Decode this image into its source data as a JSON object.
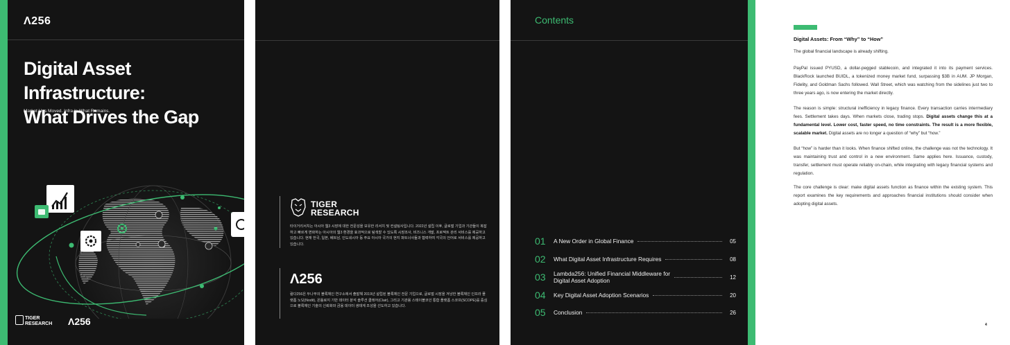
{
  "cover": {
    "logo": "Λ256",
    "title_line1": "Digital Asset Infrastructure:",
    "title_line2": "What Drives the Gap",
    "subtitle": "Market Has Moved. Infra Is What Remains.",
    "footer_logo_tiger_line1": "TIGER",
    "footer_logo_tiger_line2": "RESEARCH",
    "footer_logo_a256": "Λ256"
  },
  "about": {
    "tiger_name_line1": "TIGER",
    "tiger_name_line2": "RESEARCH",
    "tiger_desc": "타이거리서치는 아시아 웹3 시장에 대한 전문성을 보유한 리서치 및 컨설팅사입니다. 2022년 설립 이후, 글로벌 기업과 기관들이 복잡하고 빠르게 변화하는 아시아의 웹3 환경을 효과적으로 탐색할 수 있도록 시장조사, 비즈니스 개발, 프로젝트 관리 서비스를 제공하고 있습니다. 현재 한국, 일본, 베트남, 인도네시아 등 주요 아시아 국가의 현지 파트너사들과 협력하여 각국의 언어로 서비스를 제공하고 있습니다.",
    "a256_logo": "Λ256",
    "a256_desc": "람다256은 두나무의 블록체인 연구소에서 출발해 2019년 설립된 블록체인 전문 기업으로, 글로벌 시장을 겨냥한 블록체인 인프라 플랫폼 노딧(Nodit), 온톨로지 기반 데이터 분석 솔루션 클레어(Clair), 그리고 기관용 스테이블코인 통합 플랫폼 스코프(SCOPE)를 중심으로 블록체인 기술의 신뢰화와 금융 데이터 생태계 조성을 선도하고 있습니다."
  },
  "contents": {
    "title": "Contents",
    "items": [
      {
        "num": "01",
        "label": "A New Order in Global Finance",
        "page": "05"
      },
      {
        "num": "02",
        "label": "What Digital Asset Infrastructure Requires",
        "page": "08"
      },
      {
        "num": "03",
        "label_line1": "Lambda256: Unified Financial Middleware for",
        "label_line2": "Digital Asset Adoption",
        "page": "12"
      },
      {
        "num": "04",
        "label": "Key Digital Asset Adoption Scenarios",
        "page": "20"
      },
      {
        "num": "05",
        "label": "Conclusion",
        "page": "26"
      }
    ]
  },
  "article": {
    "heading": "Digital Assets: From “Why” to “How”",
    "p1": "The global financial landscape is already shifting.",
    "p2": "PayPal issued PYUSD, a dollar-pegged stablecoin, and integrated it into its payment services. BlackRock launched BUIDL, a tokenized money market fund, surpassing $3B in AUM. JP Morgan, Fidelity, and Goldman Sachs followed. Wall Street, which was watching from the sidelines just two to three years ago, is now entering the market directly.",
    "p3_a": "The reason is simple: structural inefficiency in legacy finance. Every transaction carries intermediary fees. Settlement takes days. When markets close, trading stops. ",
    "p3_b": "Digital assets change this at a fundamental level. Lower cost, faster speed, no time constraints. The result is a more flexible, scalable market.",
    "p3_c": " Digital assets are no longer a question of “why” but “how.”",
    "p4": "But “how” is harder than it looks. When finance shifted online, the challenge was not the technology. It was maintaining trust and control in a new environment. Same applies here. Issuance, custody, transfer, settlement must operate reliably on-chain, while integrating with legacy financial systems and regulation.",
    "p5": "The core challenge is clear: make digital assets function as finance within the existing system. This report examines the key requirements and approaches financial institutions should consider when adopting digital assets.",
    "page_number": "4"
  },
  "colors": {
    "accent": "#3dbb72",
    "dark": "#141414"
  }
}
